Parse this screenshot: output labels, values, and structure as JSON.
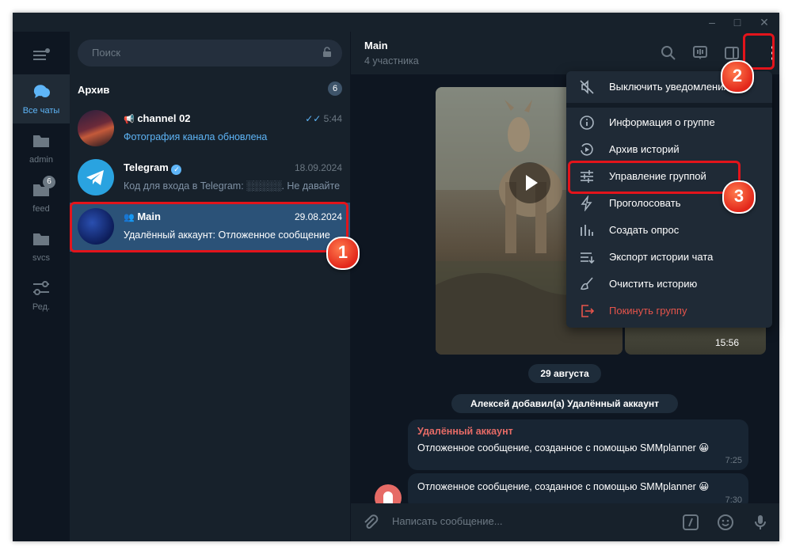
{
  "sidebar": {
    "folders": [
      {
        "label": "Все чаты",
        "badge": ""
      },
      {
        "label": "admin",
        "badge": ""
      },
      {
        "label": "feed",
        "badge": "6"
      },
      {
        "label": "svcs",
        "badge": ""
      },
      {
        "label": "Ред.",
        "badge": ""
      }
    ]
  },
  "search": {
    "placeholder": "Поиск"
  },
  "archive": {
    "title": "Архив",
    "count": "6"
  },
  "chats": [
    {
      "name": "channel 02",
      "time": "5:44",
      "preview": "Фотография канала обновлена"
    },
    {
      "name": "Telegram",
      "time": "18.09.2024",
      "preview": "Код для входа в Telegram: ░░░░░. Не давайте"
    },
    {
      "name": "Main",
      "time": "29.08.2024",
      "preview": "Удалённый аккаунт: Отложенное сообщение"
    }
  ],
  "header": {
    "title": "Main",
    "subtitle": "4 участника"
  },
  "media": {
    "time": "15:56"
  },
  "messages": {
    "date_pill": "29 августа",
    "service": "Алексей добавил(а) Удалённый аккаунт",
    "bubbles": [
      {
        "author": "Удалённый аккаунт",
        "text": "Отложенное сообщение, созданное с помощью SMMplanner 😀",
        "time": "7:25"
      },
      {
        "author": "",
        "text": "Отложенное сообщение, созданное с помощью SMMplanner 😀",
        "time": "7:30"
      }
    ]
  },
  "composer": {
    "placeholder": "Написать сообщение..."
  },
  "menu": {
    "items": [
      {
        "label": "Выключить уведомления",
        "icon": "mute-icon"
      },
      {
        "label": "Информация о группе",
        "icon": "info-icon"
      },
      {
        "label": "Архив историй",
        "icon": "stories-archive-icon"
      },
      {
        "label": "Управление группой",
        "icon": "settings-sliders-icon"
      },
      {
        "label": "Проголосовать",
        "icon": "boost-icon"
      },
      {
        "label": "Создать опрос",
        "icon": "poll-icon"
      },
      {
        "label": "Экспорт истории чата",
        "icon": "export-icon"
      },
      {
        "label": "Очистить историю",
        "icon": "broom-icon"
      },
      {
        "label": "Покинуть группу",
        "icon": "leave-icon"
      }
    ]
  },
  "annotations": [
    "1",
    "2",
    "3"
  ],
  "colors": {
    "accent": "#5eb5f7",
    "selected": "#2b5278",
    "highlight": "#e3141b",
    "danger": "#e5544b"
  }
}
